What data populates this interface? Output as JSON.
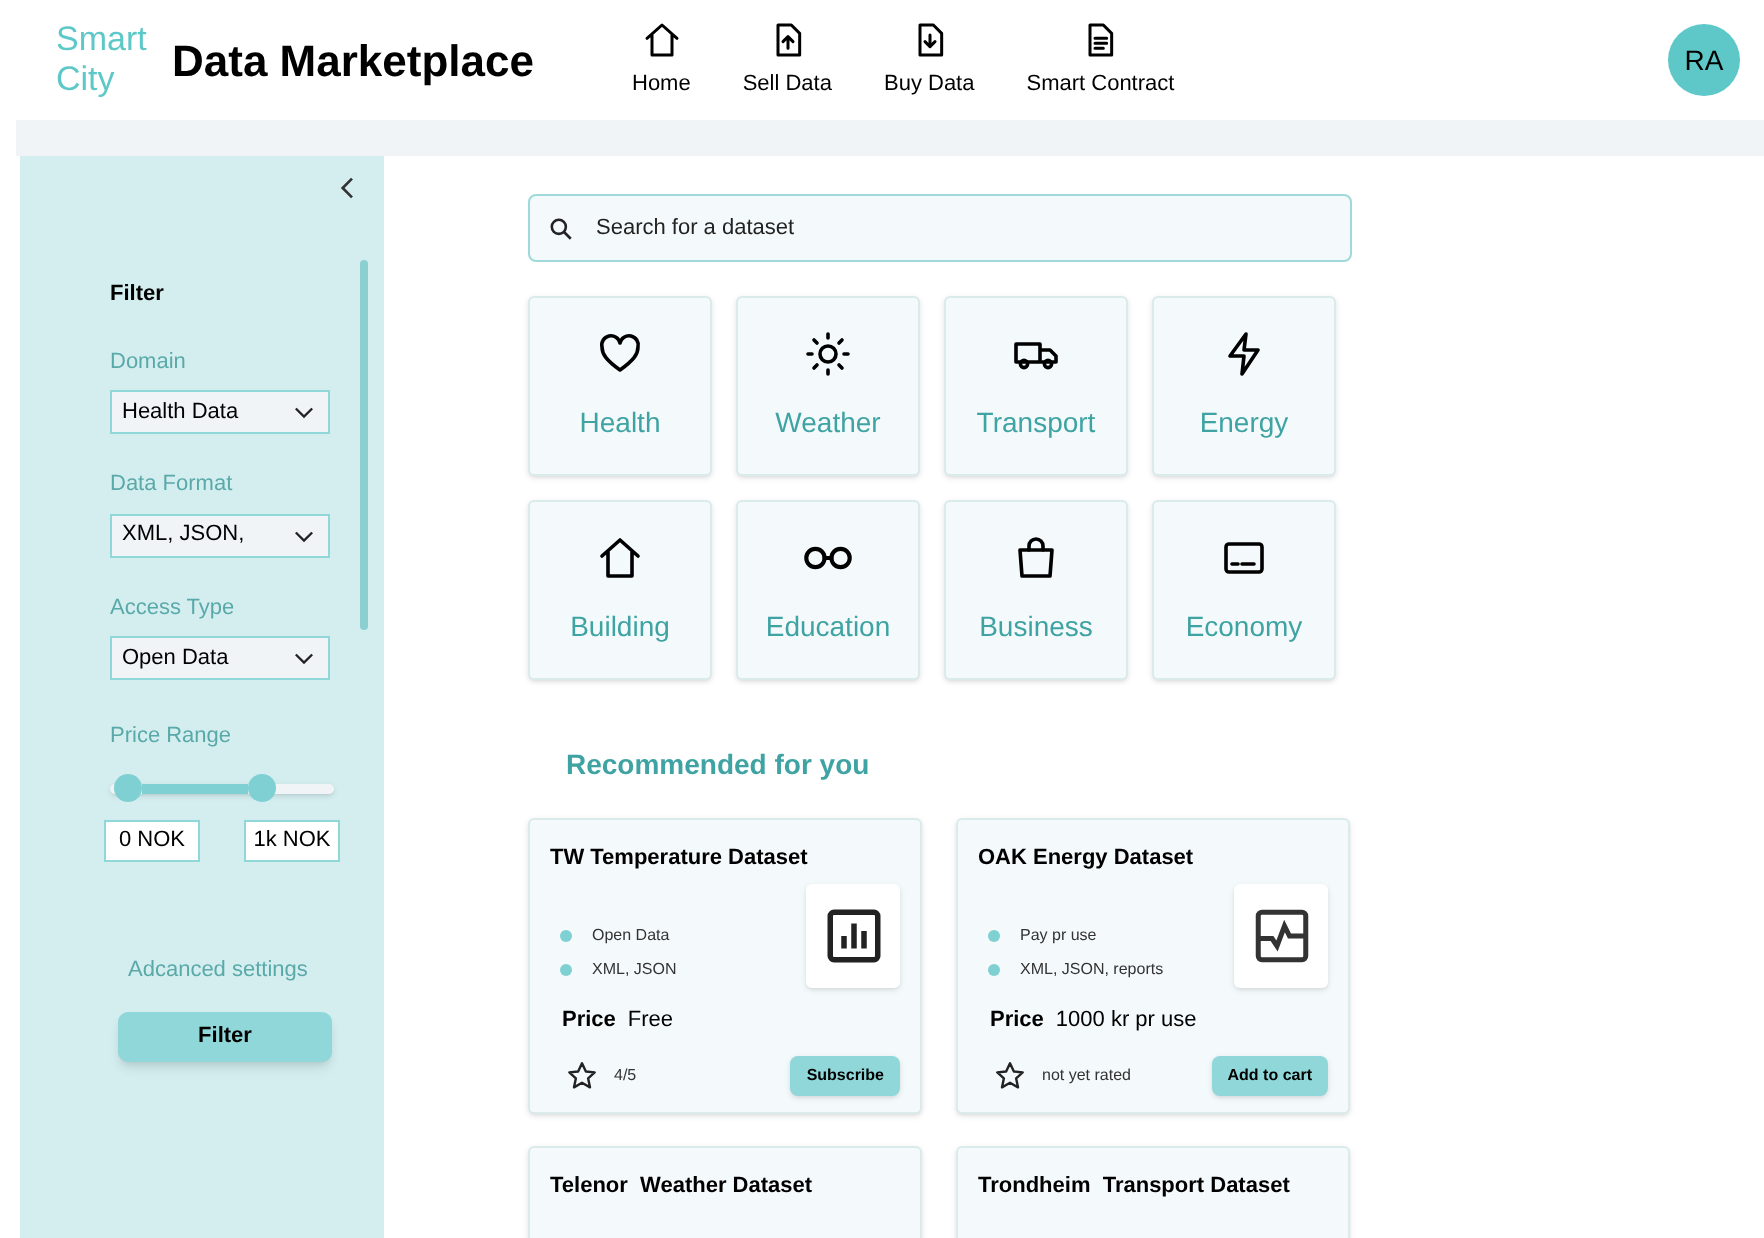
{
  "header": {
    "logo": "Smart City",
    "title": "Data Marketplace",
    "nav": [
      {
        "label": "Home",
        "kind": "home"
      },
      {
        "label": "Sell Data",
        "kind": "upload"
      },
      {
        "label": "Buy Data",
        "kind": "download"
      },
      {
        "label": "Smart Contract",
        "kind": "document"
      }
    ],
    "avatar": "RA"
  },
  "sidebar": {
    "heading": "Filter",
    "selects": [
      {
        "label": "Domain",
        "value": "Health Data"
      },
      {
        "label": "Data Format",
        "value": "XML, JSON,"
      },
      {
        "label": "Access Type",
        "value": "Open Data"
      }
    ],
    "price_range": {
      "label": "Price Range",
      "thumbs": [
        {
          "level": 0.08
        },
        {
          "level": 0.68
        }
      ],
      "min": "0 NOK",
      "max": "1k NOK"
    },
    "advanced_link": "Adcanced settings",
    "filter_button": "Filter"
  },
  "search": {
    "placeholder": "Search for a dataset"
  },
  "categories": [
    {
      "label": "Health",
      "kind": "heart"
    },
    {
      "label": "Weather",
      "kind": "sun"
    },
    {
      "label": "Transport",
      "kind": "truck"
    },
    {
      "label": "Energy",
      "kind": "bolt"
    },
    {
      "label": "Building",
      "kind": "home"
    },
    {
      "label": "Education",
      "kind": "glasses"
    },
    {
      "label": "Business",
      "kind": "bag"
    },
    {
      "label": "Economy",
      "kind": "card"
    }
  ],
  "recommended": {
    "heading": "Recommended for you",
    "datasets": [
      {
        "title": "TW Temperature Dataset",
        "tags": [
          "Open Data",
          "XML, JSON"
        ],
        "price_label": "Price",
        "price": "Free",
        "rating": "4/5",
        "action": "Subscribe",
        "kind": "bars"
      },
      {
        "title": "OAK Energy Dataset",
        "tags": [
          "Pay pr use",
          "XML, JSON, reports"
        ],
        "price_label": "Price",
        "price": "1000 kr pr use",
        "rating": "not yet rated",
        "action": "Add to cart",
        "kind": "line"
      },
      {
        "title": "Telenor  Weather Dataset"
      },
      {
        "title": "Trondheim  Transport Dataset"
      }
    ]
  }
}
